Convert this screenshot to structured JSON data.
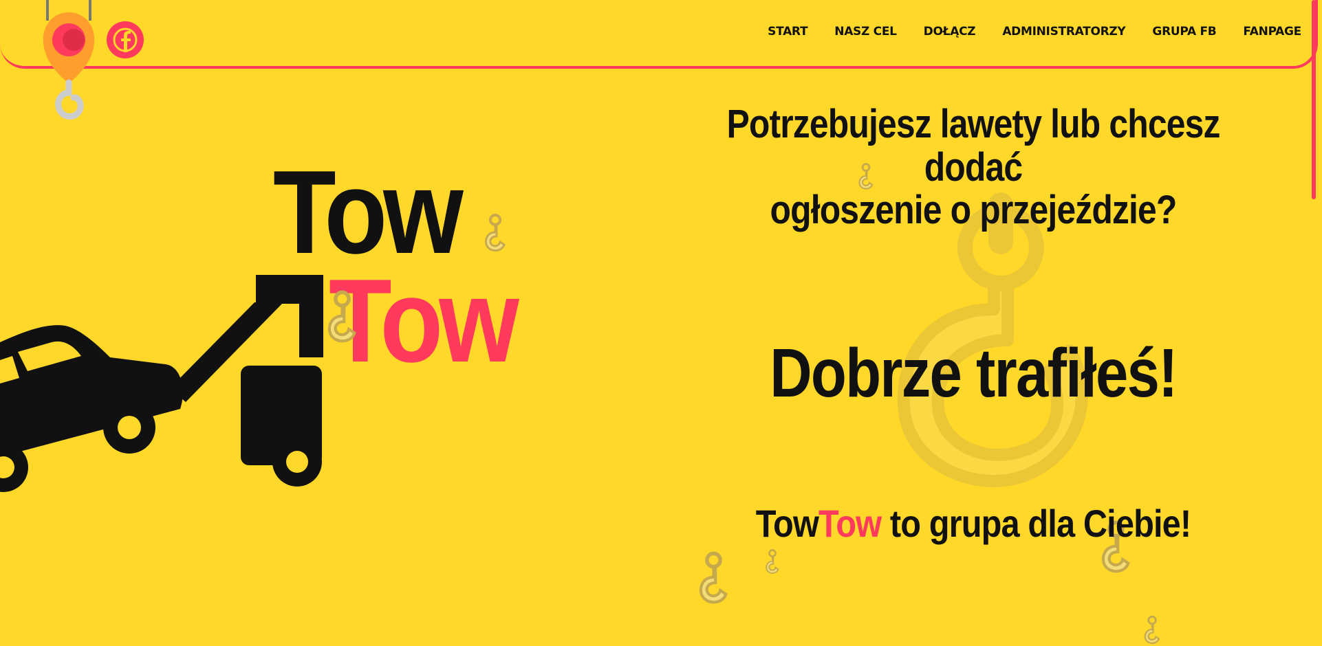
{
  "nav": {
    "items": [
      {
        "label": "START"
      },
      {
        "label": "NASZ CEL"
      },
      {
        "label": "DOŁĄCZ"
      },
      {
        "label": "ADMINISTRATORZY"
      },
      {
        "label": "GRUPA FB"
      },
      {
        "label": "FANPAGE"
      }
    ]
  },
  "brand": {
    "word1": "Tow",
    "word2": "Tow"
  },
  "hero": {
    "headline_line1": "Potrzebujesz lawety lub chcesz dodać",
    "headline_line2": "ogłoszenie o przejeździe?",
    "big": "Dobrze trafiłeś!",
    "tagline_part1": "Tow",
    "tagline_part2": "Tow",
    "tagline_rest": " to grupa dla Ciebie!"
  },
  "icons": {
    "logo": "crane-hook-icon",
    "facebook": "facebook-icon",
    "truck": "tow-truck-icon",
    "background": "hook-icon"
  },
  "colors": {
    "background": "#ffd829",
    "accent": "#ff3a5c",
    "text": "#111111"
  }
}
